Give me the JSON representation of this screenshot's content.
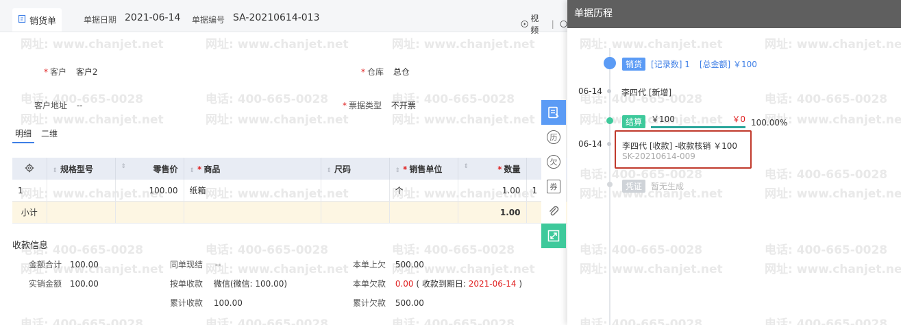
{
  "header": {
    "tab_label": "销货单",
    "date_label": "单据日期",
    "date_value": "2021-06-14",
    "no_label": "单据编号",
    "no_value": "SA-20210614-013",
    "video_label": "视频",
    "divider": "|"
  },
  "watermark": {
    "phone": "电话: 400-665-0028",
    "site": "网址: www.chanjet.net"
  },
  "form": {
    "customer_label": "客户",
    "customer_value": "客户2",
    "warehouse_label": "仓库",
    "warehouse_value": "总仓",
    "address_label": "客户地址",
    "address_value": "--",
    "invoice_label": "票据类型",
    "invoice_value": "不开票",
    "required_mark": "*"
  },
  "subtabs": [
    "明细",
    "二维"
  ],
  "table": {
    "headers": [
      "规格型号",
      "零售价",
      "商品",
      "尺码",
      "销售单位",
      "数量"
    ],
    "required_mark": "*",
    "row": {
      "no": "1",
      "spec": "",
      "price": "100.00",
      "product": "纸箱",
      "size": "",
      "unit": "个",
      "qty": "1.00",
      "extra": "1"
    },
    "subtotal": {
      "label": "小计",
      "qty": "1.00"
    }
  },
  "payment": {
    "title": "收款信息",
    "total_label": "金额合计",
    "total_value": "100.00",
    "actual_label": "实销金额",
    "actual_value": "100.00",
    "cash_label": "同单现结",
    "cash_value": "--",
    "bybill_label": "按单收款",
    "bybill_value": "微信(微信: 100.00)",
    "cumrecv_label": "累计收款",
    "cumrecv_value": "100.00",
    "prev_owe_label": "本单上欠",
    "prev_owe_value": "500.00",
    "owe_label": "本单欠款",
    "owe_value": "0.00",
    "owe_note_open": "( 收款到期日: ",
    "owe_note_date": "2021-06-14",
    "owe_note_close": " )",
    "cumowe_label": "累计欠款",
    "cumowe_value": "500.00"
  },
  "side_tools": {
    "history": "历",
    "owe": "欠",
    "coupon": "券"
  },
  "history": {
    "title": "单据历程",
    "sales_tag": "销货",
    "sales_records": "[记录数] 1",
    "sales_total": "[总金额] ￥100",
    "entry1_date": "06-14",
    "entry1_text": "李四代 [新增]",
    "settle_tag": "结算",
    "settle_amount": "￥100",
    "settle_remain": "￥0",
    "settle_percent": "100.00%",
    "settle_progress": 1.0,
    "entry2_date": "06-14",
    "entry2_text": "李四代 [收款] -收款核销 ￥100",
    "entry2_code": "SK-20210614-009",
    "voucher_tag": "凭证",
    "voucher_text": "暂无生成"
  },
  "colors": {
    "accent": "#3d7ee6",
    "green": "#3ec99b",
    "red": "#e02020",
    "highlight_box": "#c0392b",
    "header_dark": "#5f5f5f"
  }
}
